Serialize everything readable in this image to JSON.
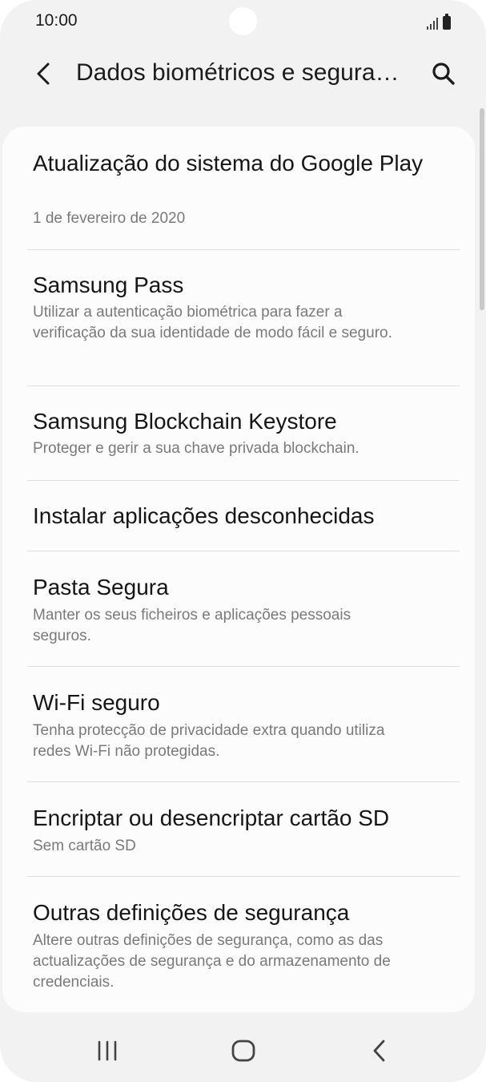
{
  "status_bar": {
    "time": "10:00",
    "icons": [
      "signal-icon",
      "battery-icon"
    ]
  },
  "toolbar": {
    "title": "Dados biométricos e segurança",
    "back_icon": "back-arrow-icon",
    "search_icon": "search-icon"
  },
  "items": [
    {
      "title": "Atualização do sistema do Google Play",
      "subtitle": "1 de fevereiro de 2020"
    },
    {
      "title": "Samsung Pass",
      "subtitle": "Utilizar a autenticação biométrica para fazer a verificação da sua identidade de modo fácil e seguro."
    },
    {
      "title": "Samsung Blockchain Keystore",
      "subtitle": "Proteger e gerir a sua chave privada blockchain."
    },
    {
      "title": "Instalar aplicações desconhecidas",
      "subtitle": ""
    },
    {
      "title": "Pasta Segura",
      "subtitle": "Manter os seus ficheiros e aplicações pessoais seguros."
    },
    {
      "title": "Wi-Fi seguro",
      "subtitle": "Tenha protecção de privacidade extra quando utiliza redes Wi-Fi não protegidas."
    },
    {
      "title": "Encriptar ou desencriptar cartão SD",
      "subtitle": "Sem cartão SD"
    },
    {
      "title": "Outras definições de segurança",
      "subtitle": "Altere outras definições de segurança, como as das actualizações de segurança e do armazenamento de credenciais."
    }
  ],
  "nav_bar": {
    "icons": [
      "recent-apps-icon",
      "home-icon",
      "back-icon"
    ]
  },
  "colors": {
    "background": "#f2f2f2",
    "card": "#fcfcfc",
    "title_text": "#161616",
    "subtitle_text": "#7a7a7a",
    "divider": "#dedede"
  }
}
